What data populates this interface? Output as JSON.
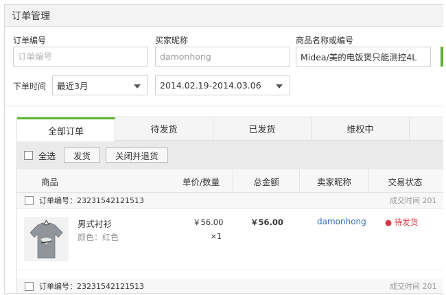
{
  "page_title": "订单管理",
  "filters": {
    "order_no_label": "订单编号",
    "order_no_placeholder": "订单编号",
    "buyer_label": "买家昵称",
    "buyer_value": "damonhong",
    "product_label": "商品名称或编号",
    "product_value": "Midea/美的电饭煲只能测控4L",
    "time_label": "下单时间",
    "time_range_selected": "最近3月",
    "date_range_selected": "2014.02.19-2014.03.06"
  },
  "tabs": [
    "全部订单",
    "待发货",
    "已发货",
    "维权中"
  ],
  "active_tab": 0,
  "toolbar": {
    "select_all": "全选",
    "ship_button": "发货",
    "close_refund_button": "关闭并退货"
  },
  "columns": {
    "product": "商品",
    "unit_price_qty": "单价/数量",
    "total": "总金额",
    "seller": "卖家昵称",
    "status": "交易状态"
  },
  "orders": [
    {
      "order_no_text": "订单编号：23231542121513",
      "time_text": "成交时间  201",
      "product_name": "男式衬衫",
      "variant": "颜色：红色",
      "price": "￥56.00",
      "qty": "×1",
      "total": "￥56.00",
      "buyer": "damonhong",
      "status": "● 待发货"
    },
    {
      "order_no_text": "订单编号：23231542121513",
      "time_text": "成交时间  201"
    }
  ],
  "colors": {
    "accent": "#5cb531",
    "link": "#2f6db5",
    "status_red": "#d9373f"
  }
}
